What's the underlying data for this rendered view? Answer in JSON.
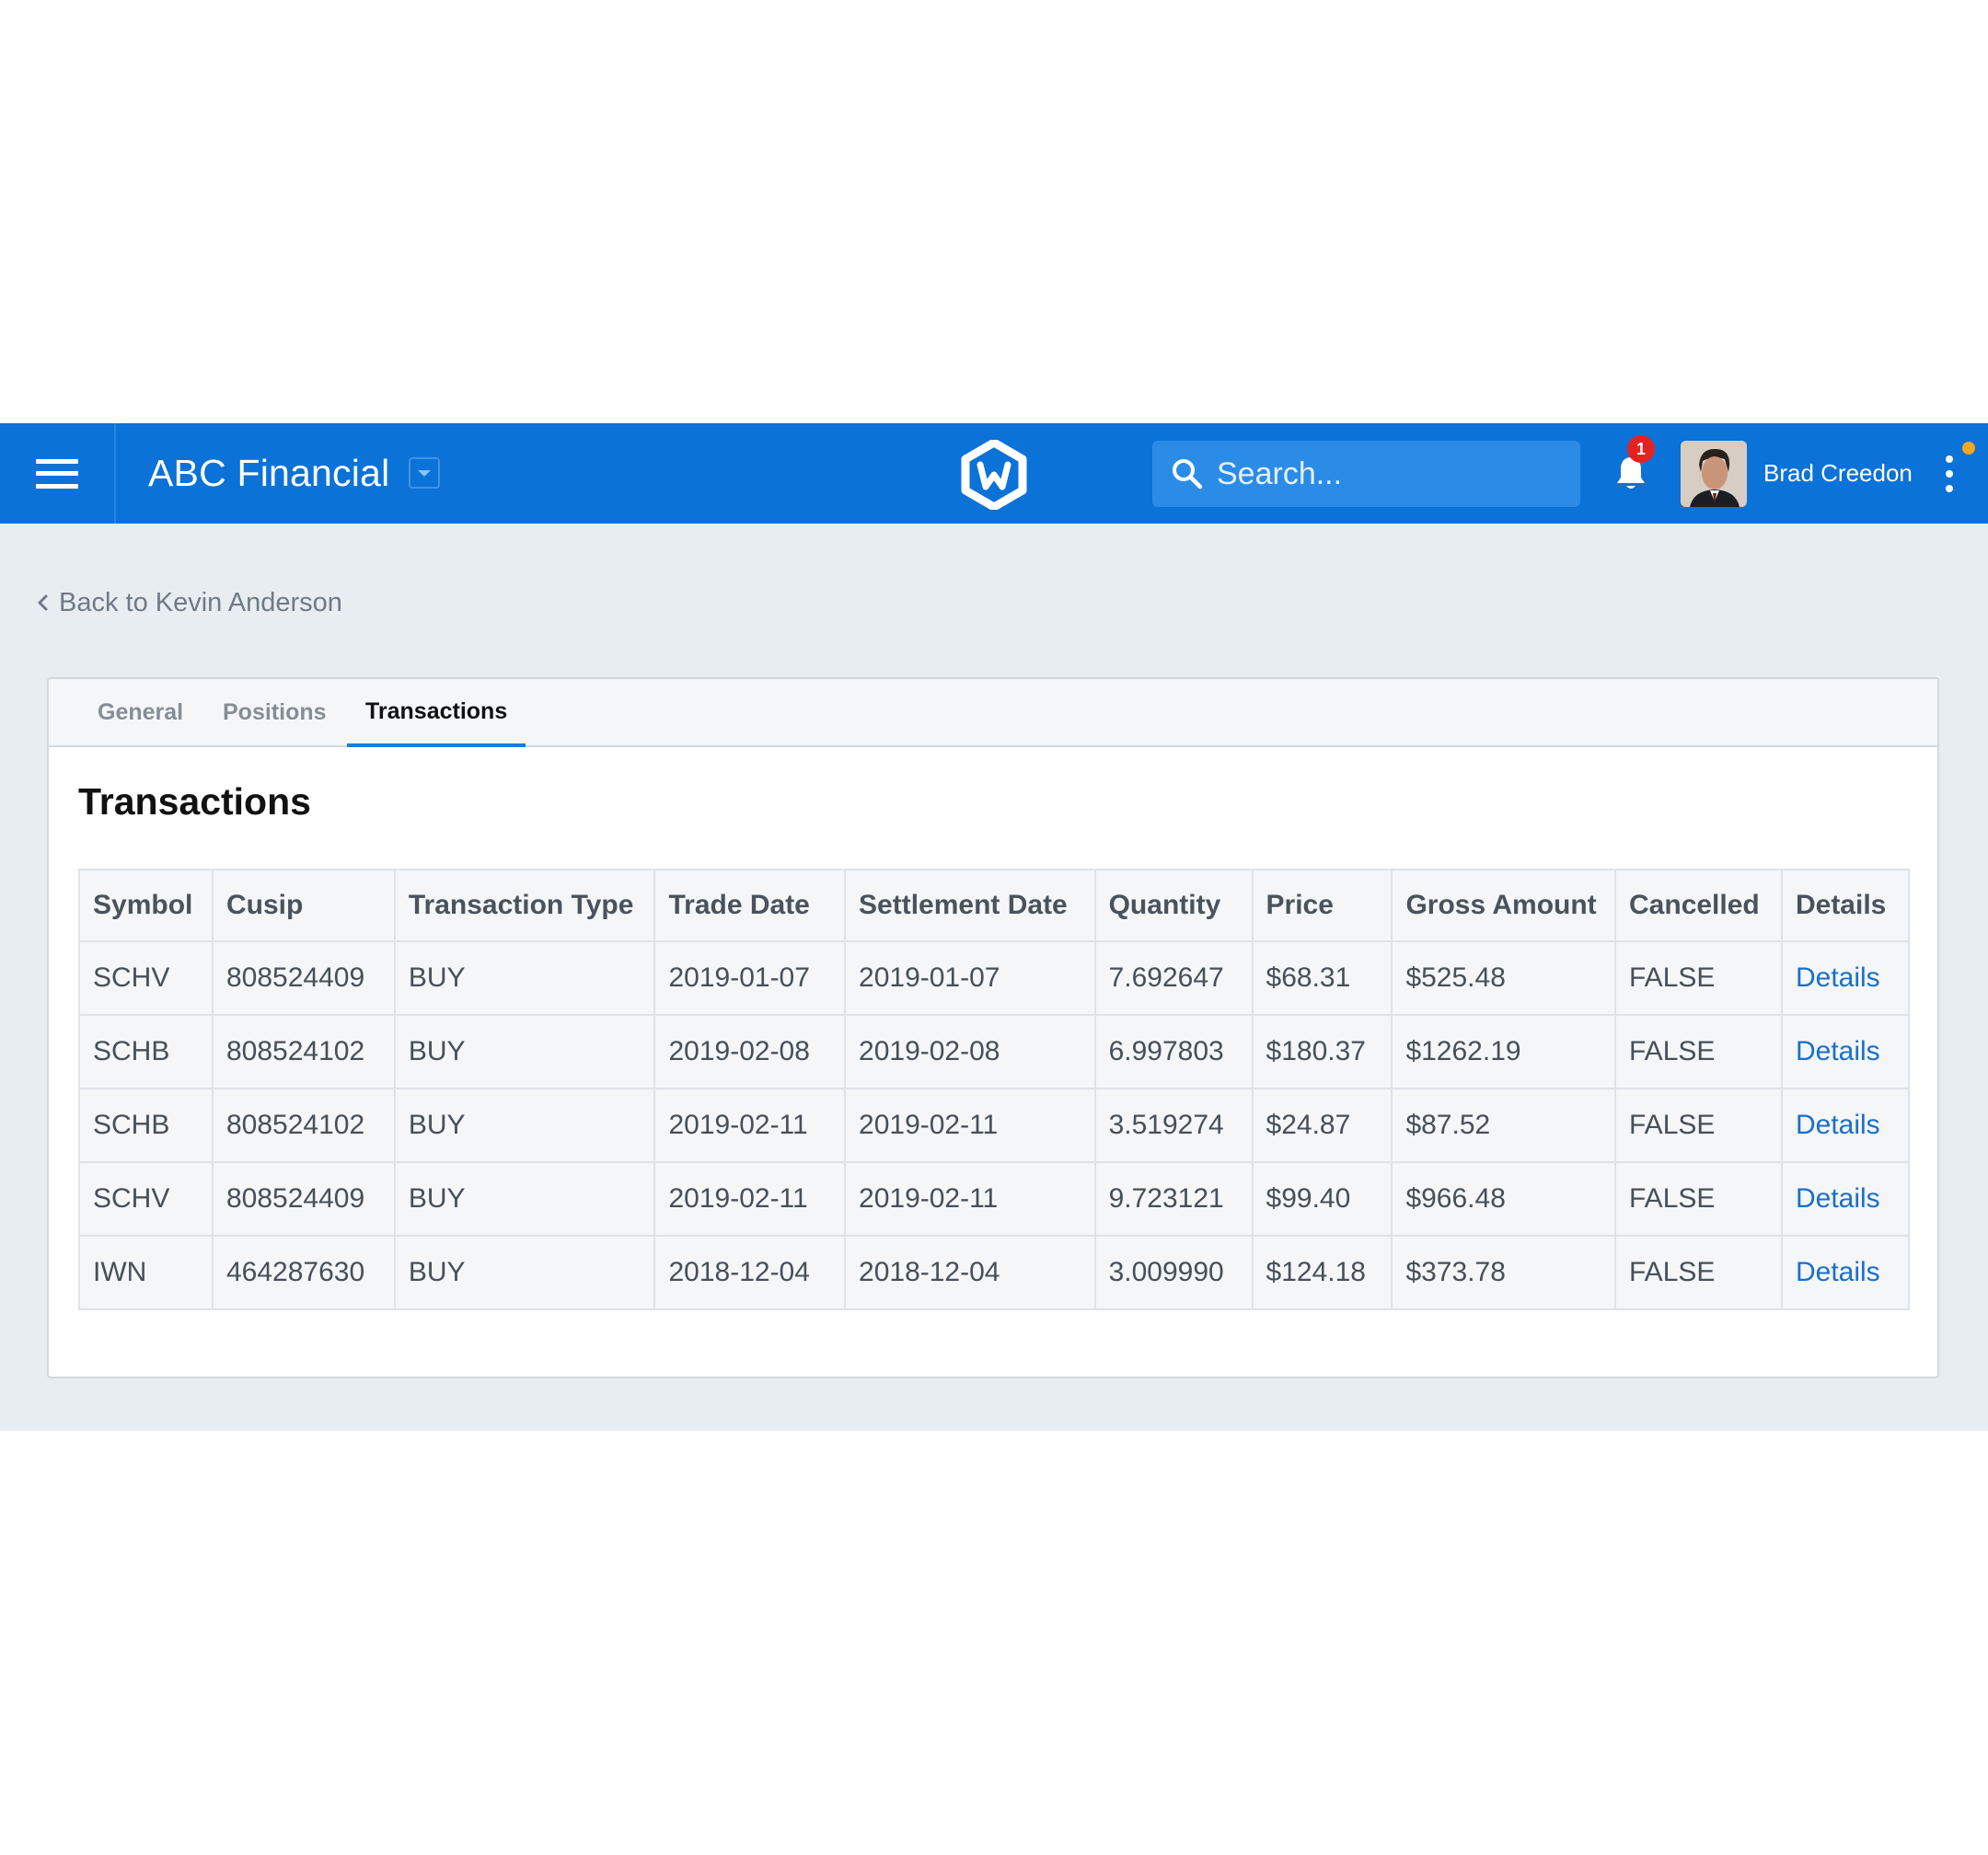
{
  "header": {
    "brand": "ABC Financial",
    "search_placeholder": "Search...",
    "notification_count": "1",
    "user_name": "Brad Creedon",
    "colors": {
      "bar": "#0b72d8",
      "badge": "#e52222",
      "status_dot": "#f5a623"
    }
  },
  "nav": {
    "back_label": "Back to Kevin Anderson"
  },
  "tabs": [
    {
      "label": "General",
      "active": false
    },
    {
      "label": "Positions",
      "active": false
    },
    {
      "label": "Transactions",
      "active": true
    }
  ],
  "section_title": "Transactions",
  "table": {
    "columns": [
      "Symbol",
      "Cusip",
      "Transaction Type",
      "Trade Date",
      "Settlement Date",
      "Quantity",
      "Price",
      "Gross Amount",
      "Cancelled",
      "Details"
    ],
    "rows": [
      [
        "SCHV",
        "808524409",
        "BUY",
        "2019-01-07",
        "2019-01-07",
        "7.692647",
        "$68.31",
        "$525.48",
        "FALSE",
        "Details"
      ],
      [
        "SCHB",
        "808524102",
        "BUY",
        "2019-02-08",
        "2019-02-08",
        "6.997803",
        "$180.37",
        "$1262.19",
        "FALSE",
        "Details"
      ],
      [
        "SCHB",
        "808524102",
        "BUY",
        "2019-02-11",
        "2019-02-11",
        "3.519274",
        "$24.87",
        "$87.52",
        "FALSE",
        "Details"
      ],
      [
        "SCHV",
        "808524409",
        "BUY",
        "2019-02-11",
        "2019-02-11",
        "9.723121",
        "$99.40",
        "$966.48",
        "FALSE",
        "Details"
      ],
      [
        "IWN",
        "464287630",
        "BUY",
        "2018-12-04",
        "2018-12-04",
        "3.009990",
        "$124.18",
        "$373.78",
        "FALSE",
        "Details"
      ]
    ]
  }
}
